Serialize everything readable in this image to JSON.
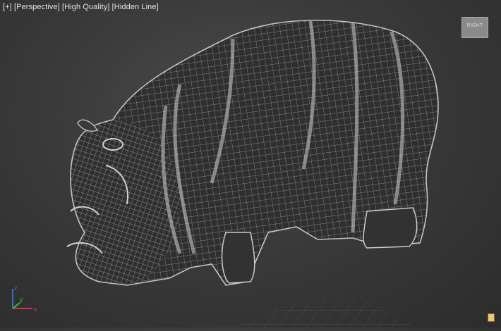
{
  "viewport": {
    "plus_label": "[+]",
    "view_label": "[Perspective]",
    "quality_label": "[High Quality]",
    "shading_label": "[Hidden Line]",
    "mesh_name": "hippo-wireframe",
    "mesh_line_color": "#b9b9b9",
    "mesh_fill_color": "#2e2e2e",
    "background_color": "#3a3a3a"
  },
  "viewcube": {
    "face_label": "RIGHT"
  },
  "axis_tripod": {
    "x_label": "x",
    "y_label": "y",
    "z_label": "z",
    "x_color": "#d23a3a",
    "y_color": "#3ac23a",
    "z_color": "#3a6ad2"
  },
  "status": {
    "corner_icon": "key-icon"
  }
}
